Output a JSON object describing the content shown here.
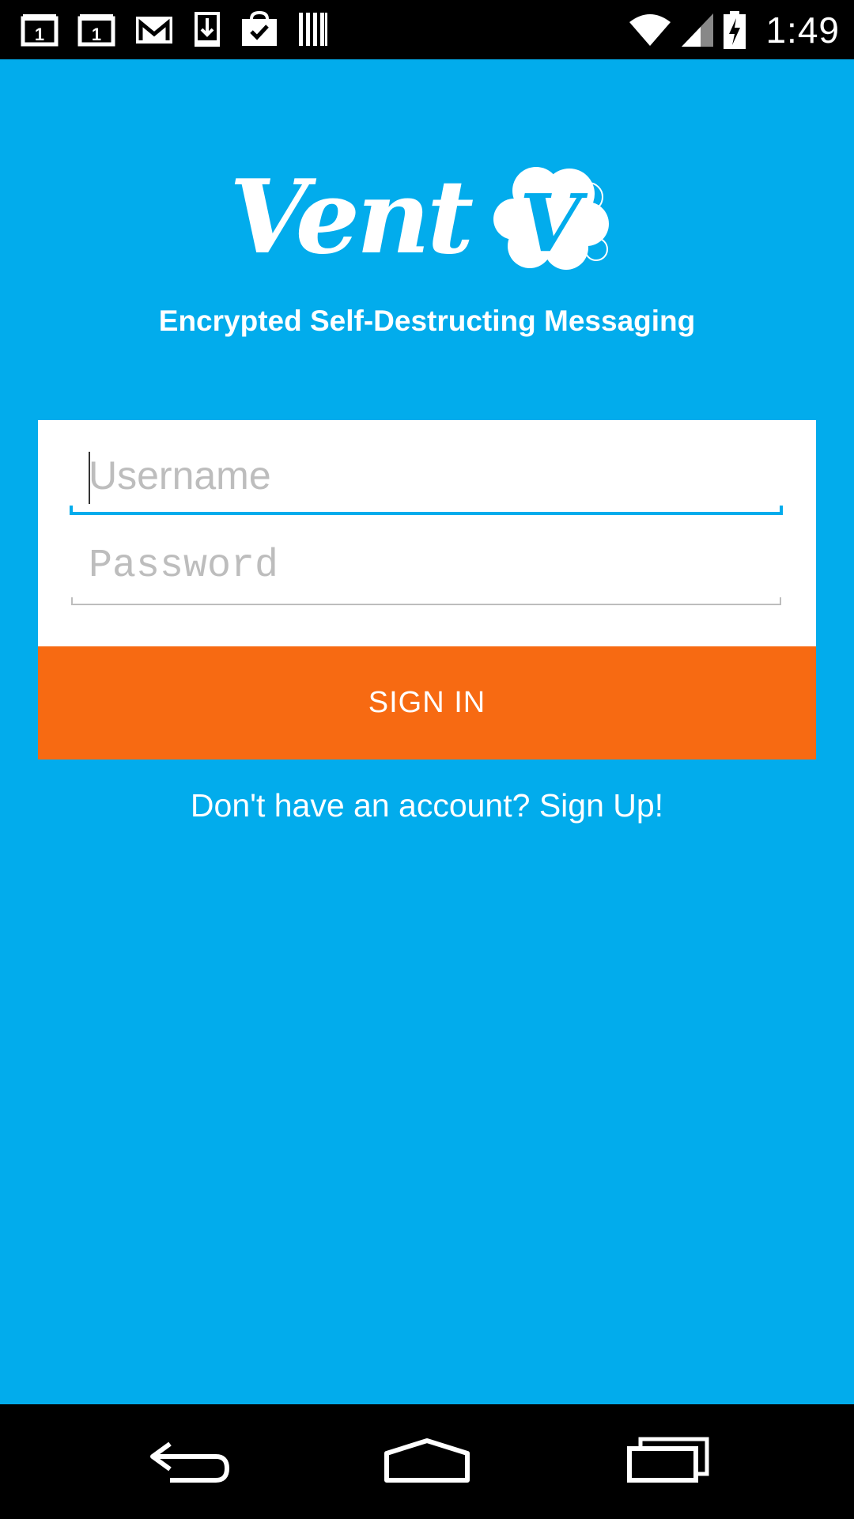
{
  "status_bar": {
    "time": "1:49",
    "notification_icons": [
      "calendar-icon",
      "calendar-icon",
      "gmail-icon",
      "download-icon",
      "play-store-icon",
      "barcode-icon"
    ],
    "system_icons": [
      "wifi-icon",
      "cell-signal-icon",
      "battery-charging-icon"
    ]
  },
  "app": {
    "logo_text": "Vent",
    "logo_mark_letter": "V",
    "tagline": "Encrypted Self-Destructing Messaging",
    "background_color": "#02acec",
    "accent_color": "#f76a12"
  },
  "login_form": {
    "username": {
      "placeholder": "Username",
      "value": ""
    },
    "password": {
      "placeholder": "Password",
      "value": ""
    },
    "signin_label": "SIGN IN",
    "signup_link": "Don't have an account? Sign Up!"
  },
  "nav_bar": {
    "buttons": [
      "back-icon",
      "home-icon",
      "recents-icon"
    ]
  }
}
